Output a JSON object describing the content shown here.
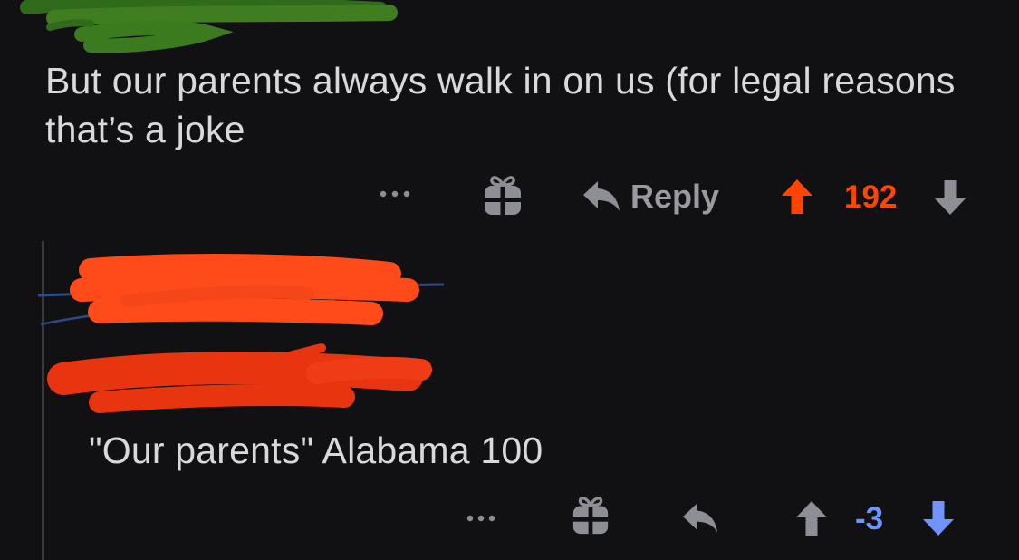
{
  "comment": {
    "body": "But our parents always walk in on us (for legal reasons that’s a joke",
    "actions": {
      "reply_label": "Reply",
      "score": "192"
    },
    "colors": {
      "upvote_active": "#ff4500",
      "score": "#ff4500",
      "muted": "#8e8f94"
    }
  },
  "reply": {
    "body": "\"Our parents\" Alabama 100",
    "actions": {
      "score": "-3"
    },
    "colors": {
      "downvote_active": "#7193ff",
      "score": "#7193ff",
      "muted": "#8e8f94"
    }
  },
  "icons": [
    "more-icon",
    "award-icon",
    "reply-icon",
    "upvote-icon",
    "downvote-icon"
  ],
  "redactions": {
    "top_username_color": "#3f7d20",
    "reply_username_color": "#ff4a1a",
    "reply_meta_color": "#e8350f"
  }
}
